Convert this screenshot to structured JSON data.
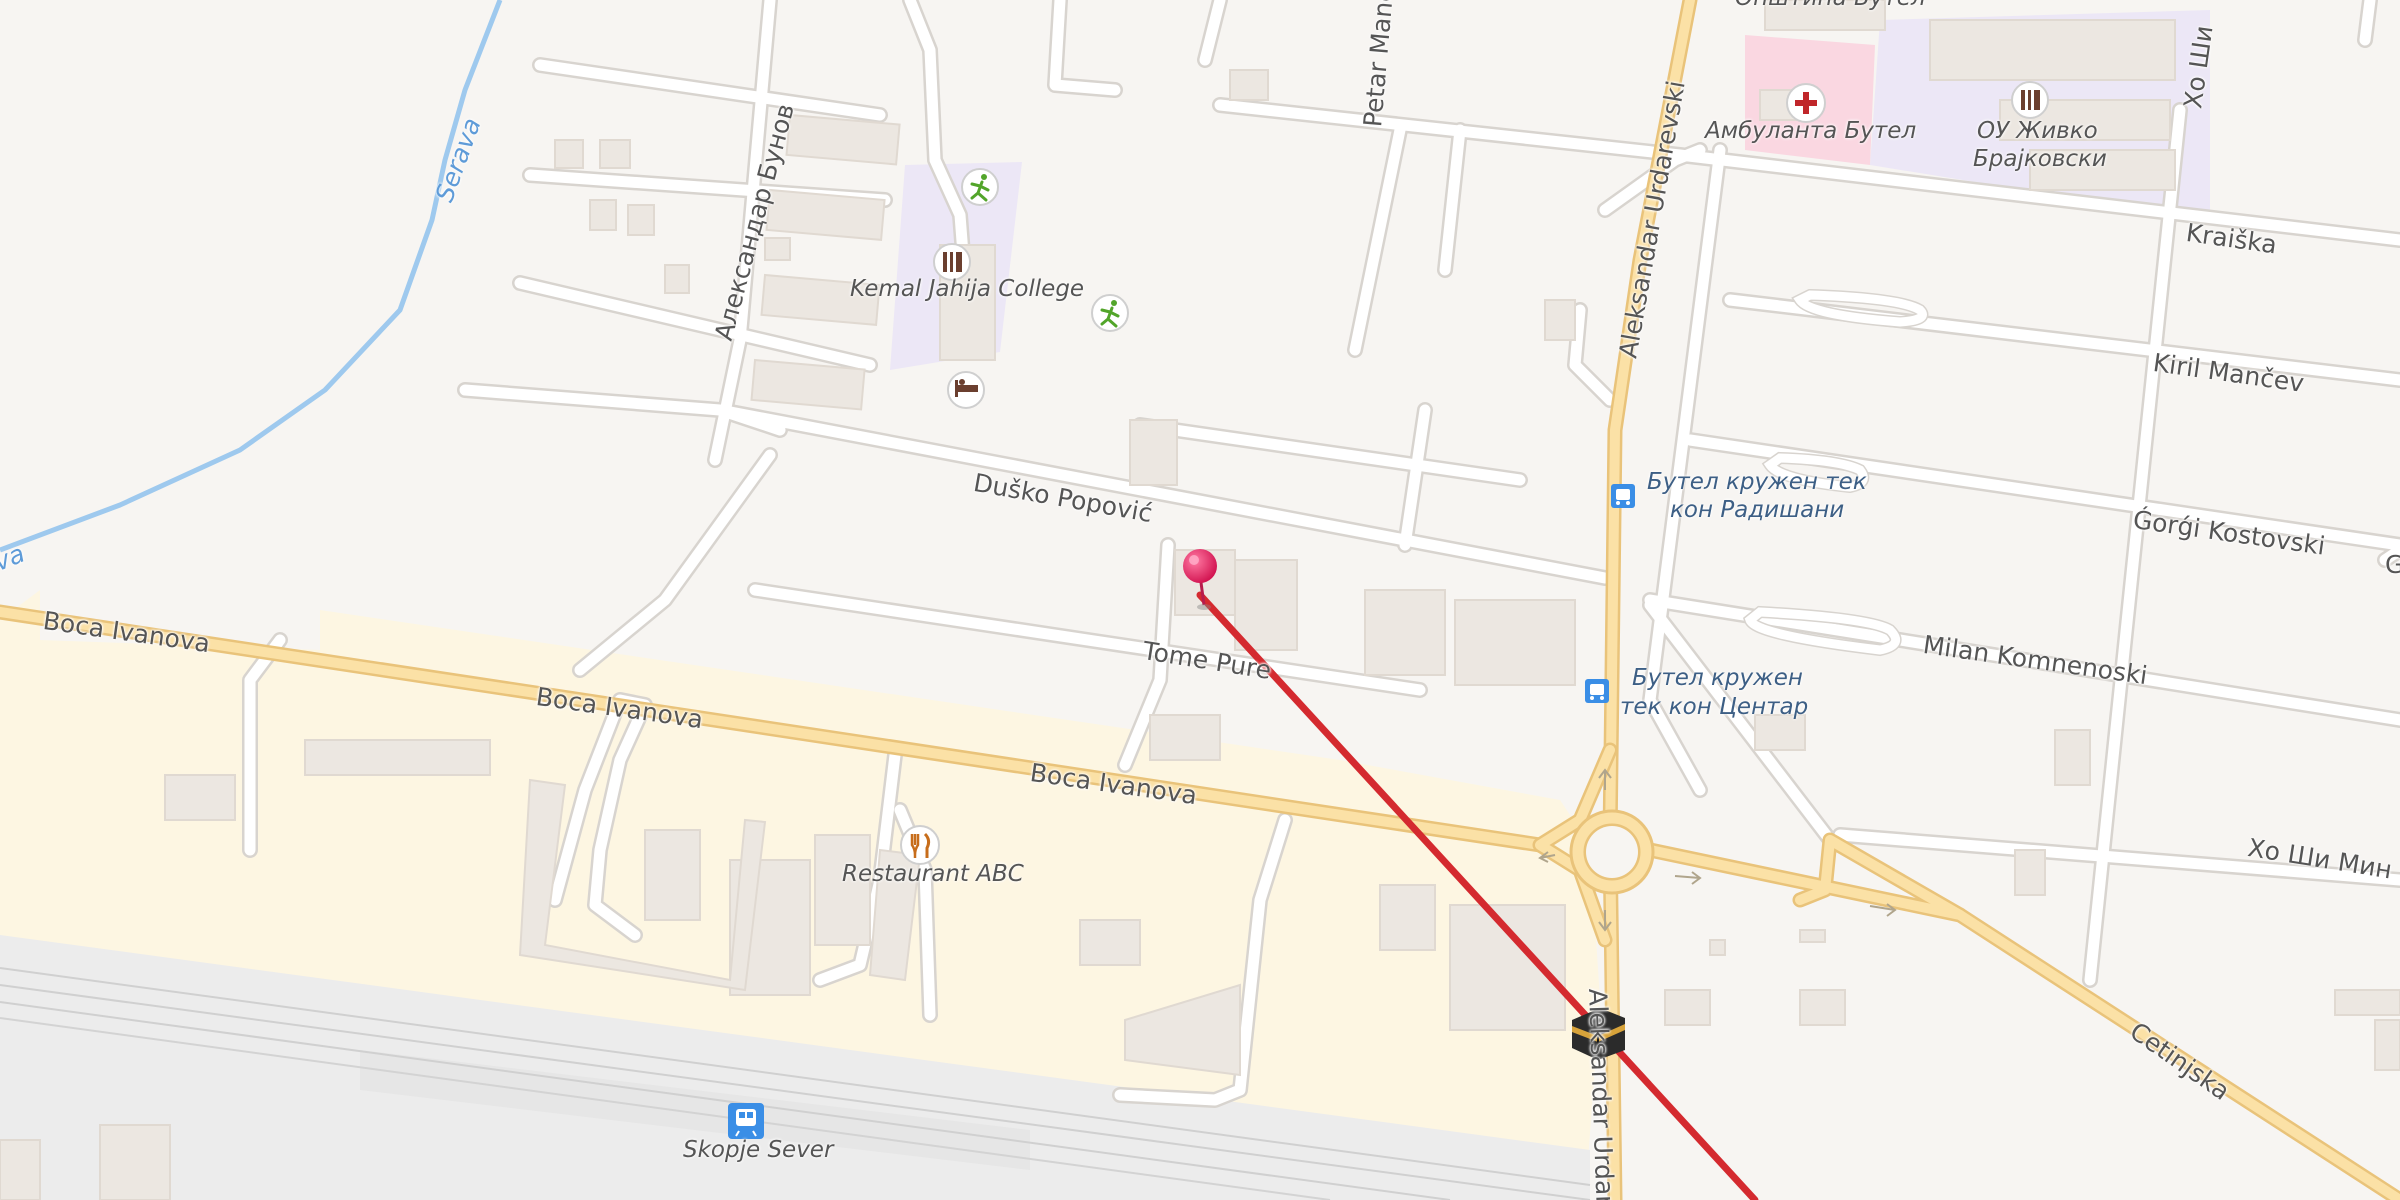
{
  "map": {
    "colors": {
      "background": "#f7f5f2",
      "minor_road": "#ffffff",
      "main_road": "#fbe1a6",
      "main_road_casing": "#e9c37a",
      "building": "#ece7e1",
      "residential_zone": "#fdf6e2",
      "school_zone": "#ece7f6",
      "hospital_zone": "#fad7e1",
      "river": "#9ec9ee",
      "route_line": "#d42a2f",
      "pin": "#e8185e"
    },
    "streets": {
      "aleksandar_bunov": "Александар Бунов",
      "petar_manc": "Petar Manc",
      "aleksandar_urdarevski_north": "Aleksandar Urdarevski",
      "aleksandar_urdarevski_south": "Aleksandar Urdare",
      "dusko_popovik": "Duško Popović",
      "tome_pure": "Tome Pure",
      "boca_ivanova_1": "Boca Ivanova",
      "boca_ivanova_2": "Boca Ivanova",
      "boca_ivanova_3": "Boca Ivanova",
      "kraiska": "Kraiška",
      "kiril_mancev": "Kiril Mančev",
      "gorgi_kostovski": "Ǵorǵi Kostovski",
      "milan_komnenoski": "Milan Komnenoski",
      "ho_shi_min": "Хо Ши Мин",
      "ho_shi_min_top": "Хо Ши",
      "cetinjska": "Cetinjska",
      "g_edge": "G"
    },
    "rivers": {
      "serava": "Serava",
      "serava_edge": "va"
    },
    "pois": {
      "kemal_college": "Kemal Jahija College",
      "ambulanta": "Амбуланта Бутел",
      "school_line1": "ОУ Живко",
      "school_line2": "Брајковски",
      "opstina_top": "Општина Бутел",
      "restaurant": "Restaurant ABC",
      "station": "Skopje Sever",
      "bus_stop_1_line1": "Бутел кружен тек",
      "bus_stop_1_line2": "кон Радишани",
      "bus_stop_2_line1": "Бутел кружен",
      "bus_stop_2_line2": "тек кон Центар"
    },
    "icons": {
      "sports_1": "running-person-icon",
      "sports_2": "running-person-icon",
      "school": "school-icon",
      "hotel": "bed-icon",
      "hospital": "red-cross-icon",
      "school_2": "school-icon",
      "restaurant": "fork-knife-icon",
      "bus_stop_1": "bus-stop-icon",
      "bus_stop_2": "bus-stop-icon",
      "train_station": "train-icon",
      "kaaba": "kaaba-icon",
      "location_pin": "map-pin-icon"
    }
  }
}
